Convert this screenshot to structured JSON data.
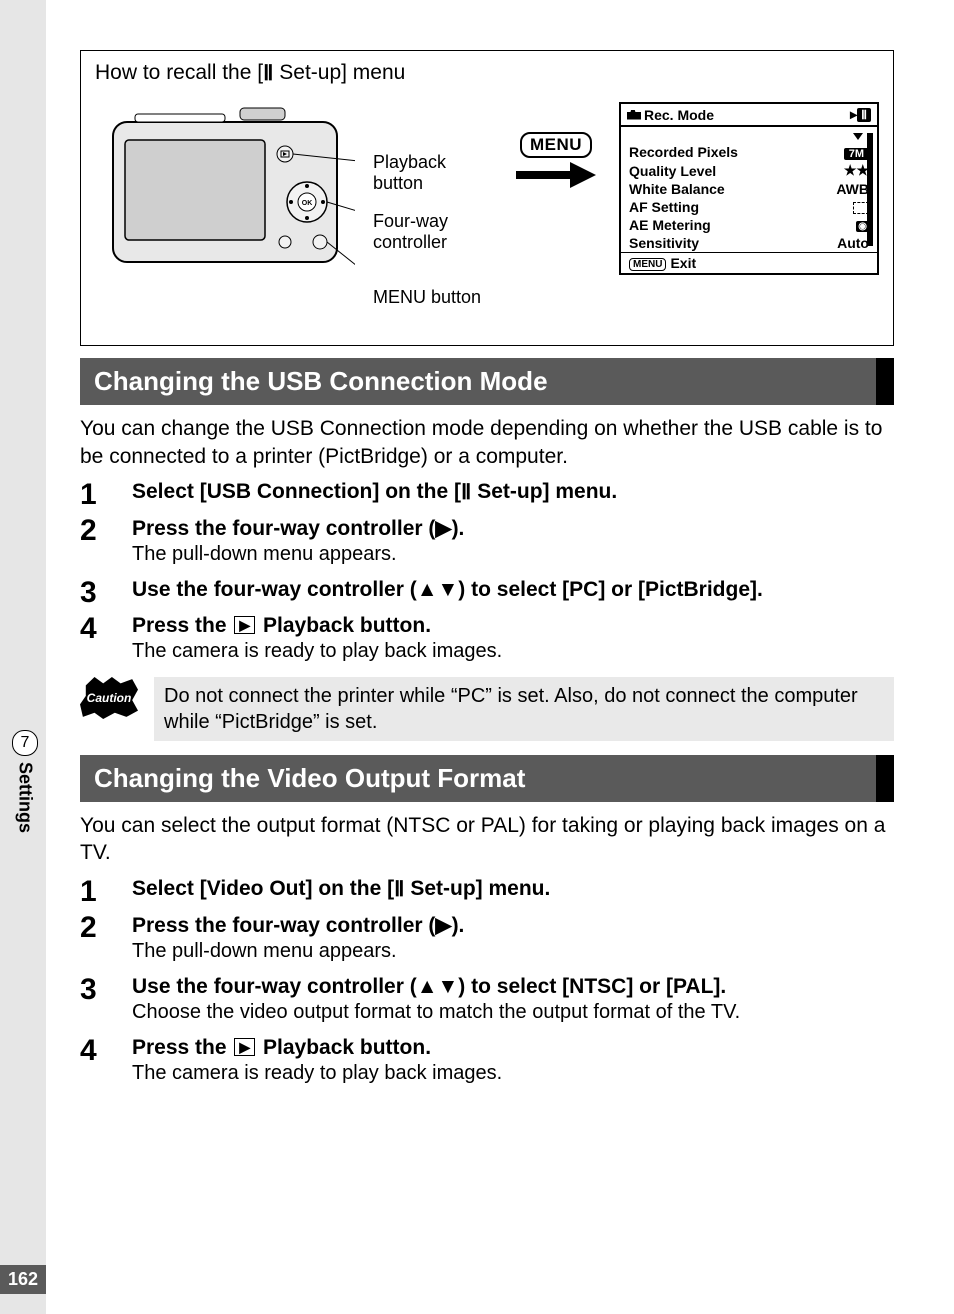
{
  "sidebar": {
    "chapter_number": "7",
    "chapter_label": "Settings",
    "page_number": "162"
  },
  "diagram": {
    "title_prefix": "How to recall the [",
    "title_suffix": " Set-up] menu",
    "setup_glyph": "Ⅱ",
    "labels": {
      "playback": "Playback button",
      "fourway": "Four-way controller",
      "menu_button": "MENU button"
    },
    "menu_badge": "MENU",
    "lcd": {
      "tab_title": "Rec. Mode",
      "items": [
        {
          "label": "Recorded Pixels",
          "value_type": "pill",
          "value": "7M"
        },
        {
          "label": "Quality Level",
          "value_type": "text",
          "value": "★★"
        },
        {
          "label": "White Balance",
          "value_type": "text",
          "value": "AWB"
        },
        {
          "label": "AF Setting",
          "value_type": "af",
          "value": ""
        },
        {
          "label": "AE Metering",
          "value_type": "meter",
          "value": "◉"
        },
        {
          "label": "Sensitivity",
          "value_type": "text",
          "value": "Auto"
        }
      ],
      "exit_label": "Exit"
    }
  },
  "sections": [
    {
      "heading": "Changing the USB Connection Mode",
      "intro": "You can change the USB Connection mode depending on whether the USB cable is to be connected to a printer (PictBridge) or a computer.",
      "steps": [
        {
          "num": "1",
          "head_pre": "Select [USB Connection] on the [",
          "head_post": " Set-up] menu.",
          "head_glyph": "Ⅱ",
          "sub": ""
        },
        {
          "num": "2",
          "head_pre": "Press the four-way controller (",
          "head_post": ").",
          "head_glyph": "▶",
          "sub": "The pull-down menu appears."
        },
        {
          "num": "3",
          "head_pre": "Use the four-way controller (",
          "head_post": ") to select [PC] or [PictBridge].",
          "head_glyph": "▲▼",
          "sub": ""
        },
        {
          "num": "4",
          "head_pre": "Press the ",
          "head_post": " Playback button.",
          "head_glyph": "play",
          "sub": "The camera is ready to play back images."
        }
      ],
      "caution": "Do not connect the printer while “PC” is set. Also, do not connect the computer while “PictBridge” is set."
    },
    {
      "heading": "Changing the Video Output Format",
      "intro": "You can select the output format (NTSC or PAL) for taking or playing back images on a TV.",
      "steps": [
        {
          "num": "1",
          "head_pre": "Select [Video Out] on the [",
          "head_post": " Set-up] menu.",
          "head_glyph": "Ⅱ",
          "sub": ""
        },
        {
          "num": "2",
          "head_pre": "Press the four-way controller (",
          "head_post": ").",
          "head_glyph": "▶",
          "sub": "The pull-down menu appears."
        },
        {
          "num": "3",
          "head_pre": "Use the four-way controller (",
          "head_post": ") to select [NTSC] or [PAL].",
          "head_glyph": "▲▼",
          "sub": "Choose the video output format to match the output format of the TV."
        },
        {
          "num": "4",
          "head_pre": "Press the ",
          "head_post": " Playback button.",
          "head_glyph": "play",
          "sub": "The camera is ready to play back images."
        }
      ],
      "caution": ""
    }
  ]
}
